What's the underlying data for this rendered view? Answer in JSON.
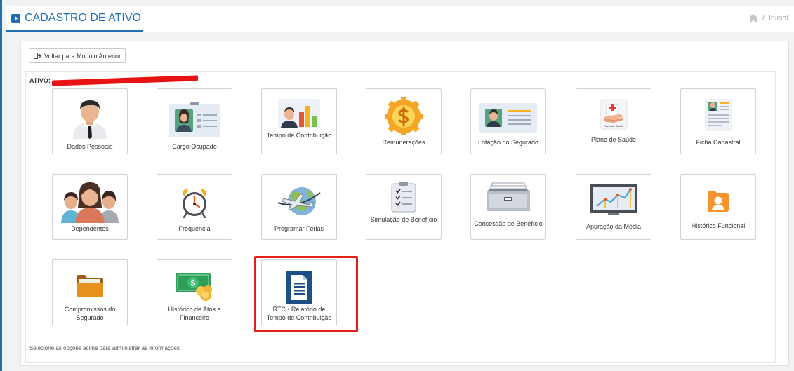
{
  "header": {
    "title": "CADASTRO DE ATIVO",
    "breadcrumb_sep": "/",
    "breadcrumb_home": "Inicial"
  },
  "back_button": {
    "label": "Voltar para Módulo Anterior"
  },
  "ativo": {
    "label": "ATIVO:"
  },
  "tiles": [
    {
      "label": "Dados Pessoais",
      "icon": "person-icon"
    },
    {
      "label": "Cargo Ocupado",
      "icon": "id-card-icon"
    },
    {
      "label": "Tempo de Contribuição",
      "icon": "person-chart-icon"
    },
    {
      "label": "Remunerações",
      "icon": "dollar-coin-icon"
    },
    {
      "label": "Lotação do Segurado",
      "icon": "id-card-lines-icon"
    },
    {
      "label": "Plano de Saúde",
      "icon": "health-plan-icon",
      "icon_text": "Plano de Saúde"
    },
    {
      "label": "Ficha Cadastral",
      "icon": "registration-form-icon"
    },
    {
      "label": "Dependentes",
      "icon": "family-group-icon"
    },
    {
      "label": "Frequência",
      "icon": "alarm-clock-icon"
    },
    {
      "label": "Programar Férias",
      "icon": "globe-plane-icon"
    },
    {
      "label": "Simulação de Benefício",
      "icon": "checklist-icon"
    },
    {
      "label": "Concessão de Benefício",
      "icon": "file-drawer-icon"
    },
    {
      "label": "Apuração da Média",
      "icon": "line-chart-icon"
    },
    {
      "label": "Histórico Funcional",
      "icon": "user-folder-icon"
    },
    {
      "label": "Compromissos do Segurado",
      "icon": "folder-icon"
    },
    {
      "label": "Histórico de Atos e Financeiro",
      "icon": "money-coins-icon"
    },
    {
      "label": "RTC - Relatório de Tempo de Contribuição",
      "icon": "document-icon"
    }
  ],
  "footer": {
    "note": "Selecione as opções acima para administrar as informações."
  },
  "colors": {
    "accent": "#1f6fb5",
    "highlight": "#e51e1e",
    "redaction": "#e81212"
  }
}
